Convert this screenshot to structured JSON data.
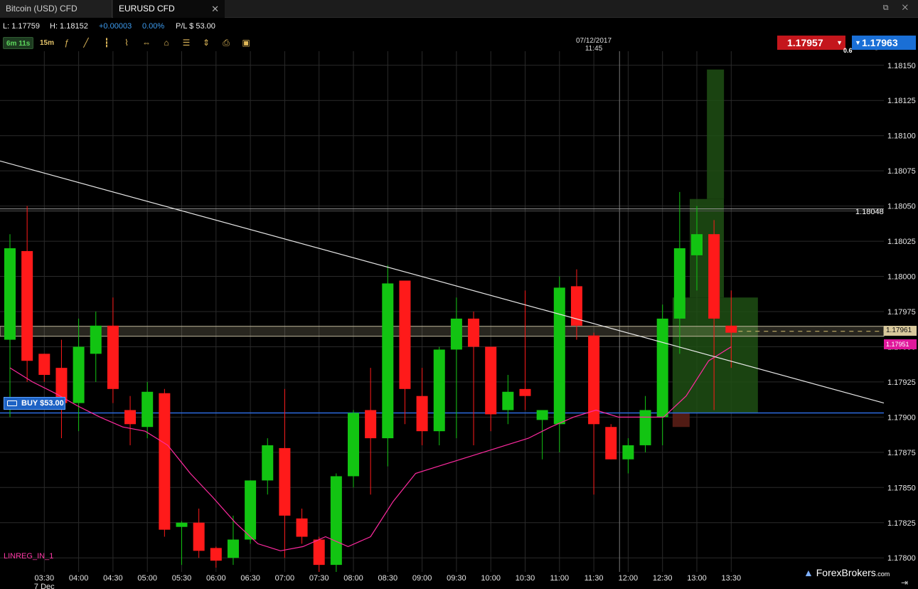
{
  "tabs": [
    {
      "label": "Bitcoin (USD) CFD",
      "active": false
    },
    {
      "label": "EURUSD CFD",
      "active": true
    }
  ],
  "tab_close_glyph": "✕",
  "window_icons": "⧉ ✕",
  "stats": {
    "low": "L: 1.17759",
    "high": "H: 1.18152",
    "change": "+0.00003",
    "change_pct": "0.00%",
    "pl": "P/L $ 53.00"
  },
  "toolbar": {
    "timer": "6m 11s",
    "timeframe": "15m",
    "icons": [
      "function-icon",
      "draw-icon",
      "candles-icon",
      "line-chart-icon",
      "range-icon",
      "tag-icon",
      "settings-sliders-icon",
      "vertical-range-icon",
      "print-icon",
      "save-icon"
    ]
  },
  "crosshair": {
    "date": "07/12/2017",
    "time": "11:45"
  },
  "prices": {
    "sell": "1.17957",
    "buy": "1.17963",
    "spread": "0.6"
  },
  "right_axis": {
    "ticks": [
      "1.18150",
      "1.18125",
      "1.18100",
      "1.18075",
      "1.18050",
      "1.18025",
      "1.18000",
      "1.17975",
      "1.17950",
      "1.17925",
      "1.17900",
      "1.17875",
      "1.17850",
      "1.17825",
      "1.17800"
    ],
    "level_label": "1.18048",
    "current_tag": "1.17961",
    "linreg_tag": "1.17951"
  },
  "time_axis": {
    "labels": [
      "03:30",
      "04:00",
      "04:30",
      "05:00",
      "05:30",
      "06:00",
      "06:30",
      "07:00",
      "07:30",
      "08:00",
      "08:30",
      "09:00",
      "09:30",
      "10:00",
      "10:30",
      "11:00",
      "11:30",
      "12:00",
      "12:30",
      "13:00",
      "13:30"
    ],
    "sub_label": "7 Dec"
  },
  "position": {
    "label": "BUY $53.00",
    "entry_price": 1.17903
  },
  "indicator": {
    "name": "LINREG_IN_1",
    "color": "#ff2aa0"
  },
  "colors": {
    "up": "#12c412",
    "down": "#ff1a1a",
    "sell": "#c4161c",
    "buy": "#1a6fd6",
    "profit_zone": "#1f4f14"
  },
  "watermark": "ForexBrokers",
  "watermark_suffix": ".com",
  "chart_data": {
    "type": "candlestick",
    "symbol": "EURUSD CFD",
    "interval": "15m",
    "ylim": [
      1.1779,
      1.1816
    ],
    "candles": [
      {
        "o": 1.17955,
        "h": 1.1803,
        "l": 1.179,
        "c": 1.1802
      },
      {
        "o": 1.18018,
        "h": 1.1805,
        "l": 1.17925,
        "c": 1.1794
      },
      {
        "o": 1.17945,
        "h": 1.17945,
        "l": 1.17925,
        "c": 1.1793
      },
      {
        "o": 1.17935,
        "h": 1.17955,
        "l": 1.17885,
        "c": 1.1791
      },
      {
        "o": 1.1791,
        "h": 1.1797,
        "l": 1.1789,
        "c": 1.1795
      },
      {
        "o": 1.17945,
        "h": 1.17975,
        "l": 1.17925,
        "c": 1.17965
      },
      {
        "o": 1.17965,
        "h": 1.17985,
        "l": 1.1791,
        "c": 1.1792
      },
      {
        "o": 1.17905,
        "h": 1.17915,
        "l": 1.1788,
        "c": 1.17895
      },
      {
        "o": 1.17893,
        "h": 1.17925,
        "l": 1.17885,
        "c": 1.17918
      },
      {
        "o": 1.17917,
        "h": 1.1792,
        "l": 1.17815,
        "c": 1.1782
      },
      {
        "o": 1.17822,
        "h": 1.17826,
        "l": 1.17795,
        "c": 1.17825
      },
      {
        "o": 1.17825,
        "h": 1.17835,
        "l": 1.178,
        "c": 1.17805
      },
      {
        "o": 1.17807,
        "h": 1.17808,
        "l": 1.17793,
        "c": 1.17798
      },
      {
        "o": 1.178,
        "h": 1.1783,
        "l": 1.17795,
        "c": 1.17813
      },
      {
        "o": 1.17813,
        "h": 1.17855,
        "l": 1.1781,
        "c": 1.17855
      },
      {
        "o": 1.17855,
        "h": 1.17885,
        "l": 1.17845,
        "c": 1.1788
      },
      {
        "o": 1.17878,
        "h": 1.1792,
        "l": 1.178,
        "c": 1.1783
      },
      {
        "o": 1.17828,
        "h": 1.17835,
        "l": 1.1781,
        "c": 1.17815
      },
      {
        "o": 1.17813,
        "h": 1.17815,
        "l": 1.1779,
        "c": 1.17795
      },
      {
        "o": 1.17795,
        "h": 1.1786,
        "l": 1.1779,
        "c": 1.17858
      },
      {
        "o": 1.17858,
        "h": 1.17905,
        "l": 1.1785,
        "c": 1.17903
      },
      {
        "o": 1.17905,
        "h": 1.17935,
        "l": 1.17845,
        "c": 1.17885
      },
      {
        "o": 1.17885,
        "h": 1.18008,
        "l": 1.17865,
        "c": 1.17995
      },
      {
        "o": 1.17997,
        "h": 1.17997,
        "l": 1.17895,
        "c": 1.1792
      },
      {
        "o": 1.17915,
        "h": 1.17935,
        "l": 1.1788,
        "c": 1.1789
      },
      {
        "o": 1.1789,
        "h": 1.1795,
        "l": 1.1788,
        "c": 1.17948
      },
      {
        "o": 1.17948,
        "h": 1.17985,
        "l": 1.17885,
        "c": 1.1797
      },
      {
        "o": 1.1797,
        "h": 1.17975,
        "l": 1.1788,
        "c": 1.1795
      },
      {
        "o": 1.1795,
        "h": 1.1795,
        "l": 1.1789,
        "c": 1.17902
      },
      {
        "o": 1.17905,
        "h": 1.1793,
        "l": 1.17895,
        "c": 1.17918
      },
      {
        "o": 1.1792,
        "h": 1.1799,
        "l": 1.17905,
        "c": 1.17915
      },
      {
        "o": 1.17898,
        "h": 1.17905,
        "l": 1.1787,
        "c": 1.17905
      },
      {
        "o": 1.17895,
        "h": 1.18,
        "l": 1.17875,
        "c": 1.17992
      },
      {
        "o": 1.17993,
        "h": 1.18005,
        "l": 1.17955,
        "c": 1.17965
      },
      {
        "o": 1.17958,
        "h": 1.1796,
        "l": 1.17845,
        "c": 1.17895
      },
      {
        "o": 1.17893,
        "h": 1.17895,
        "l": 1.1787,
        "c": 1.1787
      },
      {
        "o": 1.1787,
        "h": 1.17885,
        "l": 1.1786,
        "c": 1.1788
      },
      {
        "o": 1.1788,
        "h": 1.17915,
        "l": 1.17875,
        "c": 1.17905
      },
      {
        "o": 1.179,
        "h": 1.1798,
        "l": 1.1788,
        "c": 1.1797
      },
      {
        "o": 1.1797,
        "h": 1.1806,
        "l": 1.17945,
        "c": 1.1802
      },
      {
        "o": 1.18015,
        "h": 1.1805,
        "l": 1.1799,
        "c": 1.1803
      },
      {
        "o": 1.1803,
        "h": 1.1804,
        "l": 1.17905,
        "c": 1.1797
      },
      {
        "o": 1.17965,
        "h": 1.1799,
        "l": 1.17935,
        "c": 1.1796
      }
    ],
    "linreg": [
      1.17935,
      1.17925,
      1.17917,
      1.17908,
      1.179,
      1.17893,
      1.1789,
      1.1788,
      1.1786,
      1.17843,
      1.17825,
      1.1781,
      1.17805,
      1.17808,
      1.17815,
      1.17808,
      1.17815,
      1.1784,
      1.1786,
      1.17865,
      1.1787,
      1.17875,
      1.1788,
      1.17885,
      1.17893,
      1.179,
      1.17905,
      1.179,
      1.179,
      1.179,
      1.17915,
      1.1794,
      1.1795
    ],
    "trendline": {
      "start": 1.18082,
      "end": 1.1791
    },
    "horizontal_levels": [
      1.18048
    ],
    "current_price": 1.17961
  }
}
